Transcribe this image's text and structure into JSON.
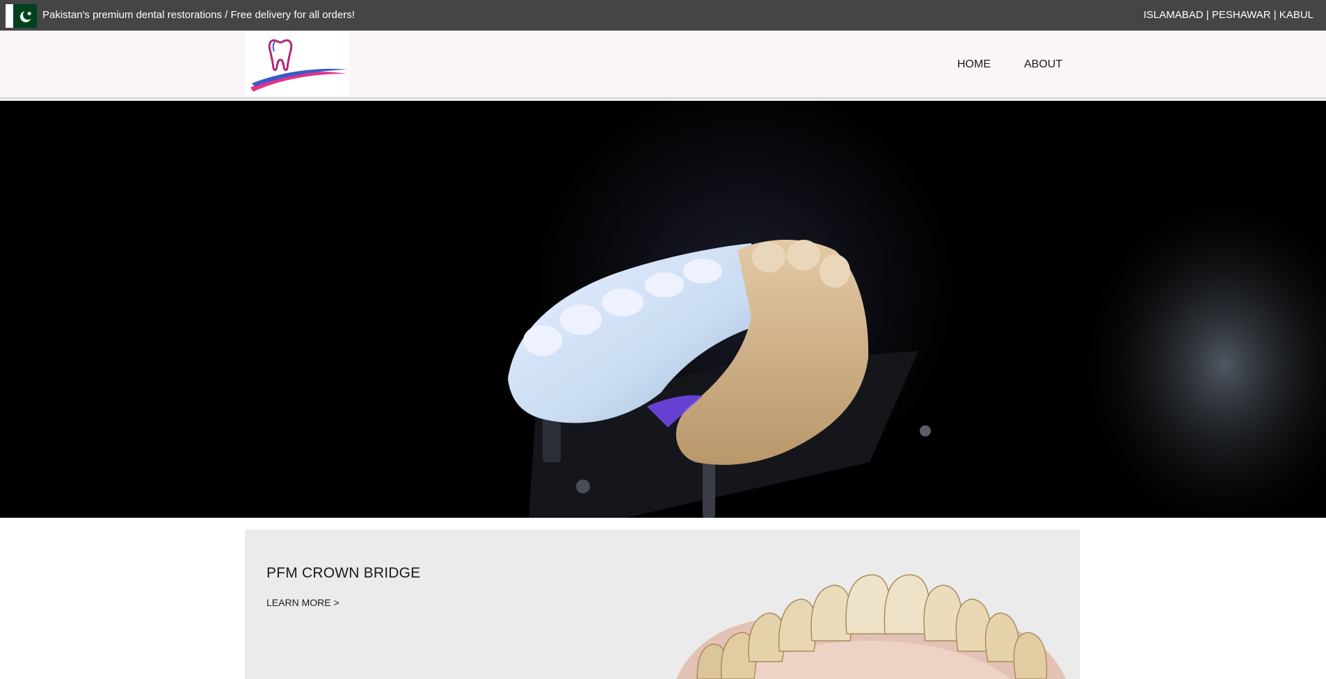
{
  "topbar": {
    "announcement": "Pakistan's premium dental restorations / Free delivery for all orders!",
    "cities": "ISLAMABAD | PESHAWAR | KABUL",
    "flag_icon": "pakistan-flag-icon"
  },
  "header": {
    "logo_icon": "tooth-logo-icon",
    "nav": [
      {
        "label": "HOME"
      },
      {
        "label": "ABOUT"
      }
    ]
  },
  "hero": {
    "image": "dental-model-scanner-photo"
  },
  "product_card": {
    "title": "PFM CROWN BRIDGE",
    "link_label": "LEARN MORE >",
    "image": "crown-bridge-teeth-photo"
  },
  "colors": {
    "topbar_bg": "#454545",
    "header_bg": "#fbf4f8",
    "hero_bg": "#000000",
    "card_bg": "#ebebeb",
    "flag_green": "#01411c",
    "logo_pink": "#e0338a",
    "logo_blue": "#3a5bc7"
  }
}
